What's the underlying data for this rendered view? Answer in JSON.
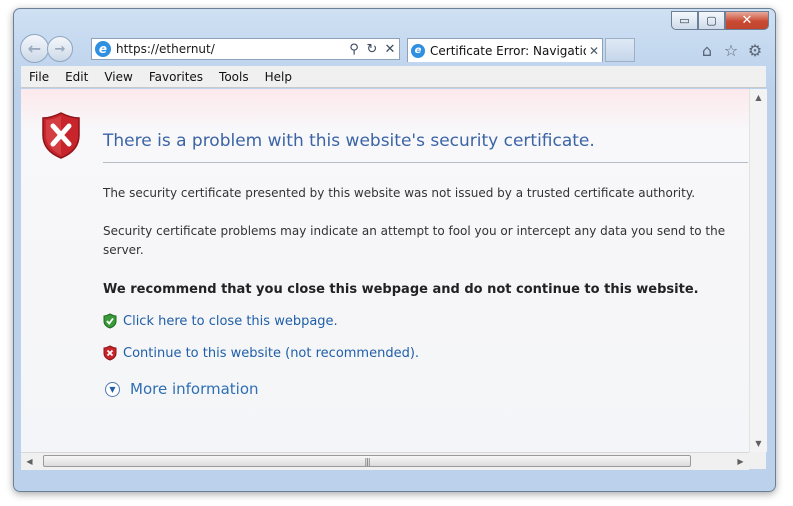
{
  "window": {
    "minimize_label": "▭",
    "maximize_label": "▢",
    "close_label": "✕"
  },
  "nav": {
    "back_icon": "back-arrow-icon",
    "forward_icon": "forward-arrow-icon",
    "address": "https://ethernut/",
    "search_icon": "search-icon",
    "refresh_icon": "refresh-icon",
    "stop_icon": "stop-icon"
  },
  "tab": {
    "label": "Certificate Error: Navigation...",
    "close": "✕"
  },
  "toolbar_icons": [
    "home-icon",
    "favorites-star-icon",
    "tools-gear-icon"
  ],
  "menu": {
    "items": [
      {
        "label": "File"
      },
      {
        "label": "Edit"
      },
      {
        "label": "View"
      },
      {
        "label": "Favorites"
      },
      {
        "label": "Tools"
      },
      {
        "label": "Help"
      }
    ]
  },
  "page": {
    "title": "There is a problem with this website's security certificate.",
    "para1": "The security certificate presented by this website was not issued by a trusted certificate authority.",
    "para2": "Security certificate problems may indicate an attempt to fool you or intercept any data you send to the server.",
    "recommend": "We recommend that you close this webpage and do not continue to this website.",
    "close_link": "Click here to close this webpage.",
    "continue_link": "Continue to this website (not recommended).",
    "more_info": "More information"
  },
  "colors": {
    "title": "#3b64a6",
    "link": "#1f5fa8",
    "shield_red": "#c7252b",
    "shield_green": "#3a9a3a"
  }
}
